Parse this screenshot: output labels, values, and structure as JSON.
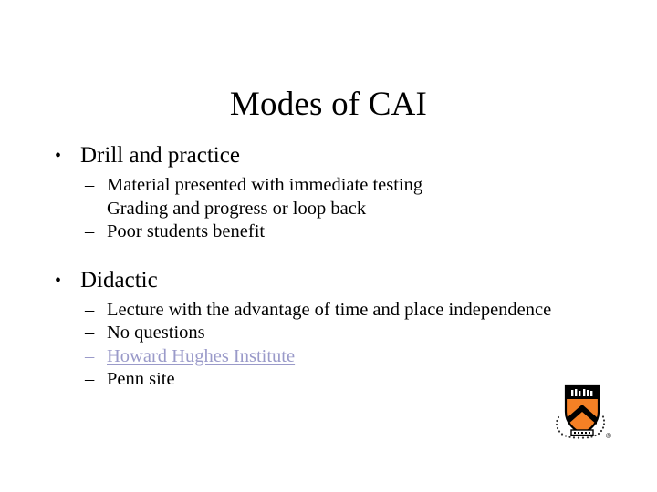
{
  "slide": {
    "title": "Modes of CAI",
    "background_color": "#ffffff",
    "text_color": "#000000",
    "link_color": "#9a9ac9",
    "sections": [
      {
        "bullet_glyph": "•",
        "heading": "Drill and practice",
        "sub_items": [
          {
            "dash_glyph": "–",
            "text": "Material presented with immediate testing",
            "is_link": false
          },
          {
            "dash_glyph": "–",
            "text": "Grading and progress or loop back",
            "is_link": false
          },
          {
            "dash_glyph": "–",
            "text": "Poor students benefit",
            "is_link": false
          }
        ]
      },
      {
        "bullet_glyph": "•",
        "heading": "Didactic",
        "sub_items": [
          {
            "dash_glyph": "–",
            "text": "Lecture with the advantage of time and place independence",
            "is_link": false
          },
          {
            "dash_glyph": "–",
            "text": "No questions",
            "is_link": false
          },
          {
            "dash_glyph": "–",
            "text": "Howard Hughes Institute",
            "is_link": true
          },
          {
            "dash_glyph": "–",
            "text": "Penn site",
            "is_link": false
          }
        ]
      }
    ],
    "logo": {
      "name": "princeton-university-shield",
      "shield_color": "#f58025",
      "chevron_color": "#000000",
      "band_color": "#000000",
      "registered_mark": "®"
    }
  }
}
